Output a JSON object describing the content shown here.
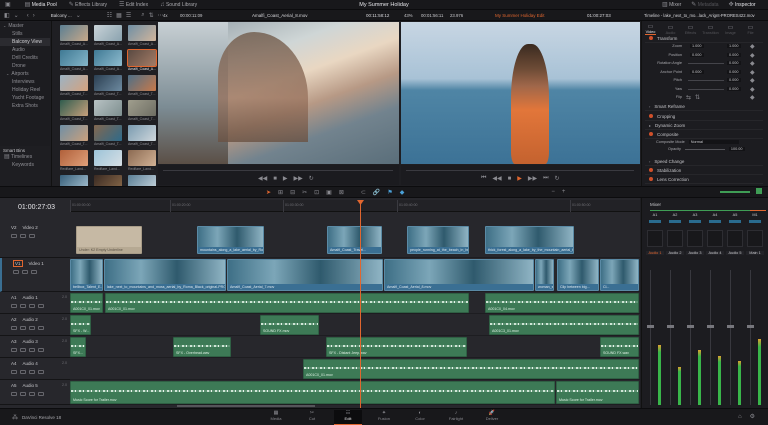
{
  "app": {
    "name": "DaVinci Resolve 18",
    "project_title": "My Summer Holiday"
  },
  "top_toolbar": {
    "left": [
      {
        "label": "Media Pool",
        "icon": "media-pool-icon"
      },
      {
        "label": "Effects Library",
        "icon": "effects-icon"
      },
      {
        "label": "Edit Index",
        "icon": "edit-index-icon"
      },
      {
        "label": "Sound Library",
        "icon": "sound-library-icon"
      }
    ],
    "right": [
      {
        "label": "Mixer",
        "icon": "mixer-icon"
      },
      {
        "label": "Metadata",
        "icon": "metadata-icon"
      },
      {
        "label": "Inspector",
        "icon": "inspector-icon"
      }
    ]
  },
  "viewer_bar": {
    "bin_name": "Balcony ...",
    "source_duration": "00:00:11:09",
    "source_clip": "Amalfi_Coast_Aerial_8.mov",
    "source_timecode": "00:11:58:12",
    "zoom": "43%",
    "timeline_duration": "00:01:56:11",
    "fps": "23.976",
    "timeline_name": "My Summer Holiday Edit",
    "timeline_timecode": "01:00:27:03",
    "inspector_title": "Timeline - lake_next_to_mo...lack_Arignt-PRORES422.mov"
  },
  "bins": {
    "items": [
      {
        "label": "Master",
        "expand": true
      },
      {
        "label": "Stills"
      },
      {
        "label": "Balcony View",
        "selected": true
      },
      {
        "label": "Audio"
      },
      {
        "label": "Drill Credits"
      },
      {
        "label": "Drone"
      },
      {
        "label": "Airports",
        "expand": true
      },
      {
        "label": "Interviews"
      },
      {
        "label": "Holiday Reel"
      },
      {
        "label": "Yacht Footage"
      },
      {
        "label": "Extra Shots"
      }
    ],
    "smart_bins_title": "Smart Bins",
    "smart_bins": [
      {
        "label": "Timelines"
      },
      {
        "label": "Keywords"
      }
    ]
  },
  "media_pool": {
    "clips": [
      "Amalfi_Coast_A...",
      "Amalfi_Coast_A...",
      "Amalfi_Coast_A...",
      "Amalfi_Coast_A...",
      "Amalfi_Coast_A...",
      "Amalfi_Coast_A...",
      "Amalfi_Coast_T...",
      "Amalfi_Coast_T...",
      "Amalfi_Coast_T...",
      "Amalfi_Coast_T...",
      "Amalfi_Coast_T...",
      "Amalfi_Coast_T...",
      "Amalfi_Coast_T...",
      "Amalfi_Coast_T...",
      "Amalfi_Coast_T...",
      "Redflare_Land...",
      "Redflare_Land...",
      "Redflare_Land...",
      "Redflare_Land...",
      "Redflare_Land...",
      "Redflare_Land..."
    ],
    "selected_index": 5
  },
  "inspector": {
    "tabs": [
      "Video",
      "Audio",
      "Effects",
      "Transition",
      "Image",
      "File"
    ],
    "active_tab": "Video",
    "transform_title": "Transform",
    "transform": [
      {
        "label": "Zoom",
        "x": "1.000",
        "y": "1.000"
      },
      {
        "label": "Position",
        "x": "0.000",
        "y": "0.000"
      },
      {
        "label": "Rotation Angle",
        "value": "0.000"
      },
      {
        "label": "Anchor Point",
        "x": "0.000",
        "y": "0.000"
      },
      {
        "label": "Pitch",
        "value": "0.000"
      },
      {
        "label": "Yaw",
        "value": "0.000"
      },
      {
        "label": "Flip"
      }
    ],
    "sections": [
      "Smart Reframe",
      "Cropping",
      "Dynamic Zoom",
      "Composite",
      "Speed Change",
      "Stabilization",
      "Lens Correction"
    ],
    "composite_mode_label": "Composite Mode",
    "composite_mode": "Normal",
    "opacity_label": "Opacity",
    "opacity": "100.00"
  },
  "timeline": {
    "timecode": "01:00:27:03",
    "ruler": [
      "01:00:00:00",
      "01:00:20:00",
      "01:00:30:00",
      "01:00:40:00",
      "01:00:50:00"
    ],
    "tracks": [
      {
        "id": "V2",
        "name": "Video 2",
        "clips": [
          "Under: K2 Empty Underline",
          "mountains_along_a_lake_aerial_by_Roma...",
          "Amalfi_Coast_Travel...",
          "people_running_at_the_beach_in_brig...",
          "thick_forest_along_a_lake_by_the_mountain_aerial_by..."
        ]
      },
      {
        "id": "V1",
        "name": "Video 1",
        "clips": [
          "bellbox_Talent_E...",
          "lake_next_to_mountains_and_moss_aerial_by_Roma_Black_original-PRORES...",
          "Amalfi_Coast_Aerial_7.mov",
          "Amalfi_Coast_Aerial_8.mov",
          "woman_sitt...",
          "Clip between big...",
          "Cl..."
        ]
      },
      {
        "id": "A1",
        "name": "Audio 1",
        "level": "2.0",
        "clips": [
          "A001C0_01.mov",
          "A001C0_01.mov",
          "A001C0_04.mov"
        ]
      },
      {
        "id": "A2",
        "name": "Audio 2",
        "level": "2.0",
        "clips": [
          "SFX - W...",
          "SOUND FX.mov",
          "A001C3_01.mov"
        ]
      },
      {
        "id": "A3",
        "name": "Audio 3",
        "level": "2.0",
        "clips": [
          "SFX...",
          "SFX - Overhead.wav",
          "SFX - Distant Jeep.wav",
          "SOUND FX.wav"
        ]
      },
      {
        "id": "A4",
        "name": "Audio 4",
        "level": "2.0",
        "clips": [
          "A001C0_01.mov"
        ]
      },
      {
        "id": "A5",
        "name": "Audio 5",
        "level": "2.0",
        "clips": [
          "Music Score for Trailer.mov",
          "Music Score for Trailer.mov"
        ]
      }
    ]
  },
  "mixer": {
    "title": "Mixer",
    "buses": [
      "A1",
      "A2",
      "A3",
      "A4",
      "A5",
      "M1"
    ],
    "channels": [
      "Audio 1",
      "Audio 2",
      "Audio 3",
      "Audio 4",
      "Audio 5",
      "Main 1"
    ],
    "meter_levels": [
      0.55,
      0.35,
      0.5,
      0.45,
      0.4,
      0.6
    ]
  },
  "pages": {
    "items": [
      "Media",
      "Cut",
      "Edit",
      "Fusion",
      "Color",
      "Fairlight",
      "Deliver"
    ],
    "active": "Edit"
  },
  "colors": {
    "accent": "#e0662f",
    "video_clip": "#3a6f93",
    "audio_clip": "#3d7a56",
    "playhead": "#e0662f"
  }
}
